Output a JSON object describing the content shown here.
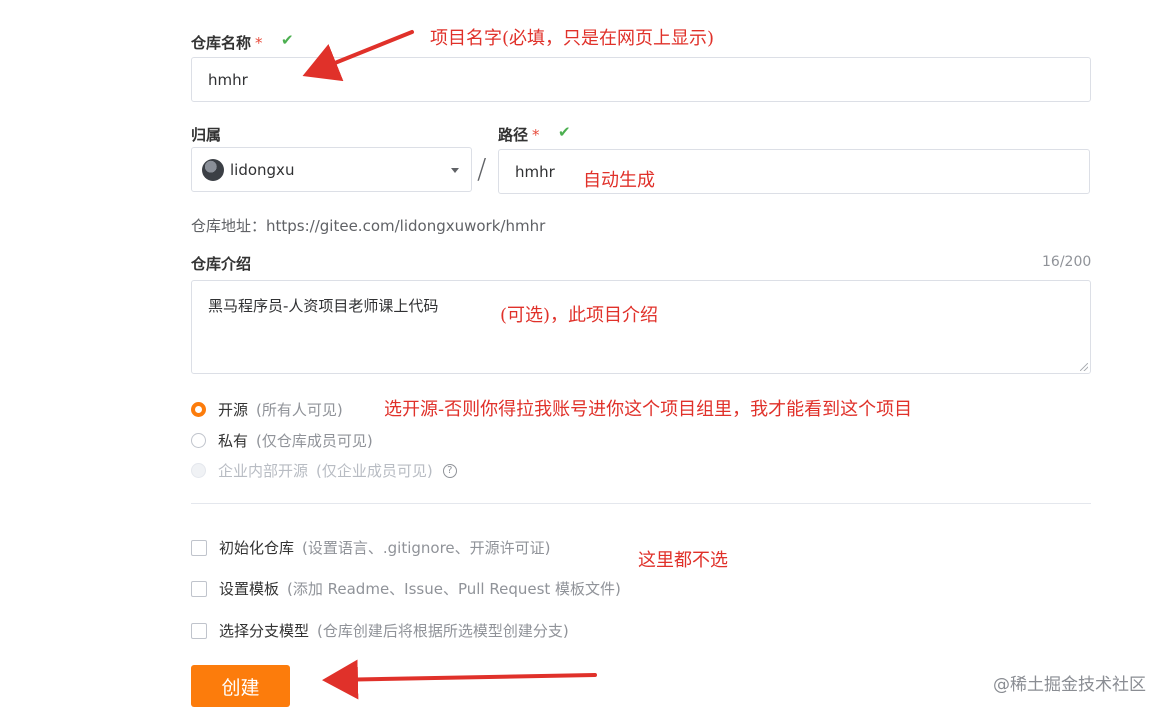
{
  "repo_name": {
    "label": "仓库名称",
    "required_mark": "*",
    "value": "hmhr",
    "annotation": "项目名字(必填，只是在网页上显示)"
  },
  "owner": {
    "label": "归属",
    "value": "lidongxu"
  },
  "separator": "/",
  "path": {
    "label": "路径",
    "required_mark": "*",
    "value": "hmhr",
    "annotation": "自动生成"
  },
  "repo_address": {
    "label": "仓库地址：",
    "url": "https://gitee.com/lidongxuwork/hmhr"
  },
  "description": {
    "label": "仓库介绍",
    "counter": "16/200",
    "value": "黑马程序员-人资项目老师课上代码",
    "annotation": "(可选)，此项目介绍"
  },
  "visibility": {
    "selected": "open",
    "options": [
      {
        "label": "开源",
        "hint": "(所有人可见)",
        "state": "checked"
      },
      {
        "label": "私有",
        "hint": "(仅仓库成员可见)",
        "state": "unchecked"
      },
      {
        "label": "企业内部开源",
        "hint": "(仅企业成员可见)",
        "state": "disabled"
      }
    ],
    "annotation": "选开源-否则你得拉我账号进你这个项目组里，我才能看到这个项目"
  },
  "init_options": {
    "items": [
      {
        "label": "初始化仓库",
        "hint": "(设置语言、.gitignore、开源许可证)",
        "checked": false
      },
      {
        "label": "设置模板",
        "hint": "(添加 Readme、Issue、Pull Request 模板文件)",
        "checked": false
      },
      {
        "label": "选择分支模型",
        "hint": "(仓库创建后将根据所选模型创建分支)",
        "checked": false
      }
    ],
    "annotation": "这里都不选"
  },
  "create_button": {
    "label": "创建"
  },
  "watermark": "@稀土掘金技术社区",
  "colors": {
    "accent": "#fc7c0c",
    "required": "#e74c3c",
    "check": "#4caf50",
    "annotation": "#e0312a",
    "border": "#dcdfe6"
  }
}
